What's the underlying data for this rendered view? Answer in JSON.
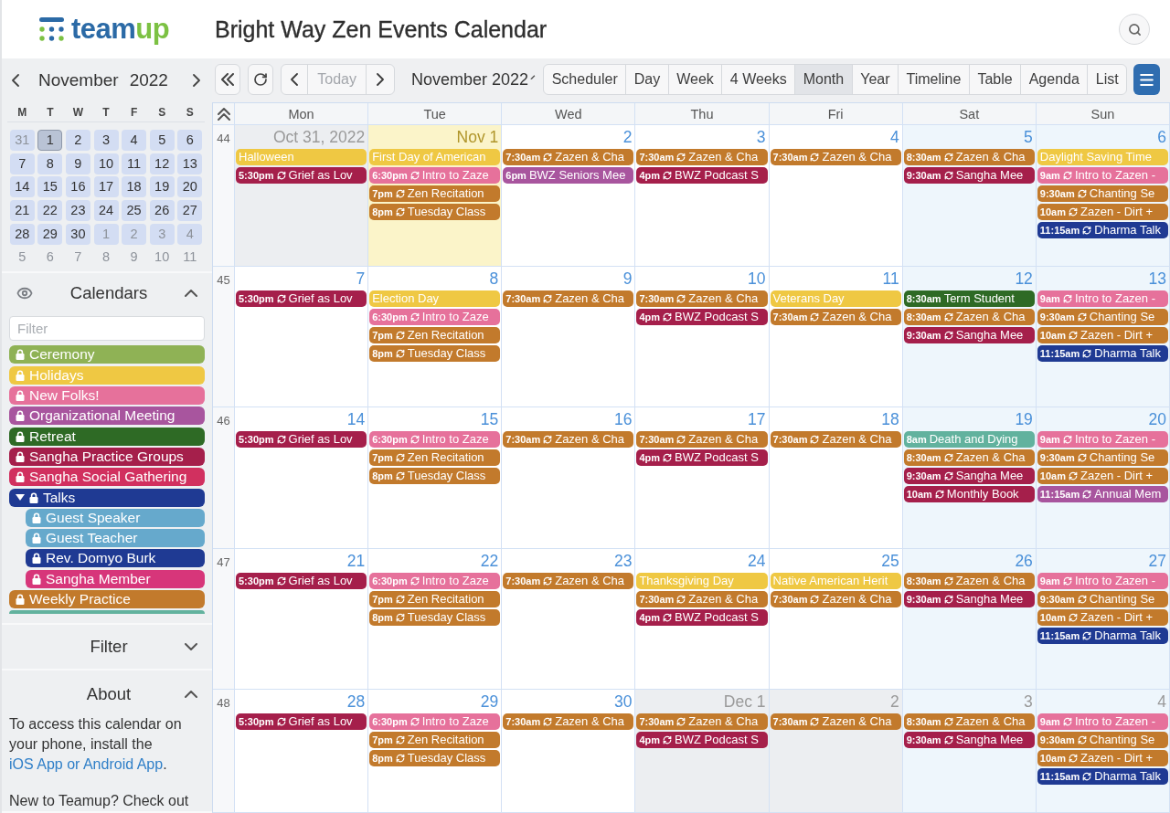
{
  "header": {
    "logo": {
      "first": "team",
      "second": "up"
    },
    "title": "Bright Way Zen Events Calendar"
  },
  "sidebar": {
    "mini_calendar": {
      "month": "November",
      "year": "2022",
      "weekdays": [
        "M",
        "T",
        "W",
        "T",
        "F",
        "S",
        "S"
      ],
      "weeks": [
        [
          {
            "label": "31",
            "in_month": false,
            "in_view": true,
            "selected": false
          },
          {
            "label": "1",
            "in_month": true,
            "in_view": true,
            "selected": true
          },
          {
            "label": "2",
            "in_month": true,
            "in_view": true,
            "selected": false
          },
          {
            "label": "3",
            "in_month": true,
            "in_view": true,
            "selected": false
          },
          {
            "label": "4",
            "in_month": true,
            "in_view": true,
            "selected": false
          },
          {
            "label": "5",
            "in_month": true,
            "in_view": true,
            "selected": false
          },
          {
            "label": "6",
            "in_month": true,
            "in_view": true,
            "selected": false
          }
        ],
        [
          {
            "label": "7",
            "in_month": true,
            "in_view": true,
            "selected": false
          },
          {
            "label": "8",
            "in_month": true,
            "in_view": true,
            "selected": false
          },
          {
            "label": "9",
            "in_month": true,
            "in_view": true,
            "selected": false
          },
          {
            "label": "10",
            "in_month": true,
            "in_view": true,
            "selected": false
          },
          {
            "label": "11",
            "in_month": true,
            "in_view": true,
            "selected": false
          },
          {
            "label": "12",
            "in_month": true,
            "in_view": true,
            "selected": false
          },
          {
            "label": "13",
            "in_month": true,
            "in_view": true,
            "selected": false
          }
        ],
        [
          {
            "label": "14",
            "in_month": true,
            "in_view": true,
            "selected": false
          },
          {
            "label": "15",
            "in_month": true,
            "in_view": true,
            "selected": false
          },
          {
            "label": "16",
            "in_month": true,
            "in_view": true,
            "selected": false
          },
          {
            "label": "17",
            "in_month": true,
            "in_view": true,
            "selected": false
          },
          {
            "label": "18",
            "in_month": true,
            "in_view": true,
            "selected": false
          },
          {
            "label": "19",
            "in_month": true,
            "in_view": true,
            "selected": false
          },
          {
            "label": "20",
            "in_month": true,
            "in_view": true,
            "selected": false
          }
        ],
        [
          {
            "label": "21",
            "in_month": true,
            "in_view": true,
            "selected": false
          },
          {
            "label": "22",
            "in_month": true,
            "in_view": true,
            "selected": false
          },
          {
            "label": "23",
            "in_month": true,
            "in_view": true,
            "selected": false
          },
          {
            "label": "24",
            "in_month": true,
            "in_view": true,
            "selected": false
          },
          {
            "label": "25",
            "in_month": true,
            "in_view": true,
            "selected": false
          },
          {
            "label": "26",
            "in_month": true,
            "in_view": true,
            "selected": false
          },
          {
            "label": "27",
            "in_month": true,
            "in_view": true,
            "selected": false
          }
        ],
        [
          {
            "label": "28",
            "in_month": true,
            "in_view": true,
            "selected": false
          },
          {
            "label": "29",
            "in_month": true,
            "in_view": true,
            "selected": false
          },
          {
            "label": "30",
            "in_month": true,
            "in_view": true,
            "selected": false
          },
          {
            "label": "1",
            "in_month": false,
            "in_view": true,
            "selected": false
          },
          {
            "label": "2",
            "in_month": false,
            "in_view": true,
            "selected": false
          },
          {
            "label": "3",
            "in_month": false,
            "in_view": true,
            "selected": false
          },
          {
            "label": "4",
            "in_month": false,
            "in_view": true,
            "selected": false
          }
        ],
        [
          {
            "label": "5",
            "in_month": false,
            "in_view": false,
            "selected": false
          },
          {
            "label": "6",
            "in_month": false,
            "in_view": false,
            "selected": false
          },
          {
            "label": "7",
            "in_month": false,
            "in_view": false,
            "selected": false
          },
          {
            "label": "8",
            "in_month": false,
            "in_view": false,
            "selected": false
          },
          {
            "label": "9",
            "in_month": false,
            "in_view": false,
            "selected": false
          },
          {
            "label": "10",
            "in_month": false,
            "in_view": false,
            "selected": false
          },
          {
            "label": "11",
            "in_month": false,
            "in_view": false,
            "selected": false
          }
        ]
      ]
    },
    "calendars": {
      "title": "Calendars",
      "expanded": true,
      "filter": {
        "placeholder": "Filter"
      },
      "items": [
        {
          "name": "Ceremony",
          "color": "#8fb255",
          "locked": true
        },
        {
          "name": "Holidays",
          "color": "#efc843",
          "locked": true
        },
        {
          "name": "New Folks!",
          "color": "#e6719b",
          "locked": true
        },
        {
          "name": "Organizational Meeting",
          "color": "#a8559e",
          "locked": true
        },
        {
          "name": "Retreat",
          "color": "#2e6a25",
          "locked": true
        },
        {
          "name": "Sangha Practice Groups",
          "color": "#a51f4b",
          "locked": true
        },
        {
          "name": "Sangha Social Gathering",
          "color": "#d1305f",
          "locked": true
        },
        {
          "name": "Talks",
          "color": "#1f3a93",
          "locked": true,
          "expanded": true,
          "children": [
            {
              "name": "Guest Speaker",
              "color": "#66a9cc",
              "locked": true
            },
            {
              "name": "Guest Teacher",
              "color": "#66a9cc",
              "locked": true
            },
            {
              "name": "Rev. Domyo Burk",
              "color": "#1f3a93",
              "locked": true
            },
            {
              "name": "Sangha Member",
              "color": "#d7367a",
              "locked": true
            }
          ]
        },
        {
          "name": "Weekly Practice",
          "color": "#c27a2c",
          "locked": true
        },
        {
          "color": "#62b29e"
        }
      ]
    },
    "filter_panel": {
      "title": "Filter",
      "expanded": false
    },
    "about_panel": {
      "title": "About",
      "expanded": true,
      "paragraphs": [
        {
          "before": "To access this calendar on your phone, install the ",
          "link": "iOS App or Android App",
          "after": "."
        },
        {
          "before": "New to Teamup? Check out"
        }
      ]
    }
  },
  "toolbar": {
    "today": {
      "label": "Today",
      "disabled": true
    },
    "title": "November 2022",
    "views": [
      {
        "label": "Scheduler",
        "selected": false
      },
      {
        "label": "Day",
        "selected": false
      },
      {
        "label": "Week",
        "selected": false
      },
      {
        "label": "4 Weeks",
        "selected": false
      },
      {
        "label": "Month",
        "selected": true
      },
      {
        "label": "Year",
        "selected": false
      },
      {
        "label": "Timeline",
        "selected": false
      },
      {
        "label": "Table",
        "selected": false
      },
      {
        "label": "Agenda",
        "selected": false
      },
      {
        "label": "List",
        "selected": false
      }
    ]
  },
  "calendar": {
    "weekdays": [
      "Mon",
      "Tue",
      "Wed",
      "Thu",
      "Fri",
      "Sat",
      "Sun"
    ],
    "weeks": [
      {
        "number": "44",
        "days": [
          {
            "label": "Oct 31, 2022",
            "in_month": false,
            "today": false,
            "events": [
              {
                "kind": "all_day",
                "title": "Halloween",
                "color": "#efc843"
              },
              {
                "kind": "timed",
                "time": "5:30pm",
                "repeat": true,
                "title": "Grief as Lov",
                "color": "#a51f4b"
              }
            ]
          },
          {
            "label": "Nov 1",
            "in_month": true,
            "today": true,
            "events": [
              {
                "kind": "all_day",
                "title": "First Day of American",
                "color": "#efc843"
              },
              {
                "kind": "timed",
                "time": "6:30pm",
                "repeat": true,
                "title": "Intro to Zaze",
                "color": "#e6719b"
              },
              {
                "kind": "timed",
                "time": "7pm",
                "repeat": true,
                "title": "Zen Recitation",
                "color": "#c27a2c"
              },
              {
                "kind": "timed",
                "time": "8pm",
                "repeat": true,
                "title": "Tuesday Class",
                "color": "#c27a2c"
              }
            ]
          },
          {
            "label": "2",
            "in_month": true,
            "today": false,
            "events": [
              {
                "kind": "timed",
                "time": "7:30am",
                "repeat": true,
                "title": "Zazen & Cha",
                "color": "#c27a2c"
              },
              {
                "kind": "timed",
                "time": "6pm",
                "repeat": false,
                "title": "BWZ Seniors Mee",
                "color": "#a8559e"
              }
            ]
          },
          {
            "label": "3",
            "in_month": true,
            "today": false,
            "events": [
              {
                "kind": "timed",
                "time": "7:30am",
                "repeat": true,
                "title": "Zazen & Cha",
                "color": "#c27a2c"
              },
              {
                "kind": "timed",
                "time": "4pm",
                "repeat": true,
                "title": "BWZ Podcast S",
                "color": "#a51f4b"
              }
            ]
          },
          {
            "label": "4",
            "in_month": true,
            "today": false,
            "events": [
              {
                "kind": "timed",
                "time": "7:30am",
                "repeat": true,
                "title": "Zazen & Cha",
                "color": "#c27a2c"
              }
            ]
          },
          {
            "label": "5",
            "in_month": true,
            "today": false,
            "events": [
              {
                "kind": "timed",
                "time": "8:30am",
                "repeat": true,
                "title": "Zazen & Cha",
                "color": "#c27a2c"
              },
              {
                "kind": "timed",
                "time": "9:30am",
                "repeat": true,
                "title": "Sangha Mee",
                "color": "#a51f4b"
              }
            ]
          },
          {
            "label": "6",
            "in_month": true,
            "today": false,
            "events": [
              {
                "kind": "all_day",
                "title": "Daylight Saving Time",
                "color": "#efc843"
              },
              {
                "kind": "timed",
                "time": "9am",
                "repeat": true,
                "title": "Intro to Zazen -",
                "color": "#e6719b"
              },
              {
                "kind": "timed",
                "time": "9:30am",
                "repeat": true,
                "title": "Chanting Se",
                "color": "#c27a2c"
              },
              {
                "kind": "timed",
                "time": "10am",
                "repeat": true,
                "title": "Zazen - Dirt +",
                "color": "#c27a2c"
              },
              {
                "kind": "timed",
                "time": "11:15am",
                "repeat": true,
                "title": "Dharma Talk",
                "color": "#1f3a93"
              }
            ]
          }
        ]
      },
      {
        "number": "45",
        "days": [
          {
            "label": "7",
            "in_month": true,
            "today": false,
            "events": [
              {
                "kind": "timed",
                "time": "5:30pm",
                "repeat": true,
                "title": "Grief as Lov",
                "color": "#a51f4b"
              }
            ]
          },
          {
            "label": "8",
            "in_month": true,
            "today": false,
            "events": [
              {
                "kind": "all_day",
                "title": "Election Day",
                "color": "#efc843"
              },
              {
                "kind": "timed",
                "time": "6:30pm",
                "repeat": true,
                "title": "Intro to Zaze",
                "color": "#e6719b"
              },
              {
                "kind": "timed",
                "time": "7pm",
                "repeat": true,
                "title": "Zen Recitation",
                "color": "#c27a2c"
              },
              {
                "kind": "timed",
                "time": "8pm",
                "repeat": true,
                "title": "Tuesday Class",
                "color": "#c27a2c"
              }
            ]
          },
          {
            "label": "9",
            "in_month": true,
            "today": false,
            "events": [
              {
                "kind": "timed",
                "time": "7:30am",
                "repeat": true,
                "title": "Zazen & Cha",
                "color": "#c27a2c"
              }
            ]
          },
          {
            "label": "10",
            "in_month": true,
            "today": false,
            "events": [
              {
                "kind": "timed",
                "time": "7:30am",
                "repeat": true,
                "title": "Zazen & Cha",
                "color": "#c27a2c"
              },
              {
                "kind": "timed",
                "time": "4pm",
                "repeat": true,
                "title": "BWZ Podcast S",
                "color": "#a51f4b"
              }
            ]
          },
          {
            "label": "11",
            "in_month": true,
            "today": false,
            "events": [
              {
                "kind": "all_day",
                "title": "Veterans Day",
                "color": "#efc843"
              },
              {
                "kind": "timed",
                "time": "7:30am",
                "repeat": true,
                "title": "Zazen & Cha",
                "color": "#c27a2c"
              }
            ]
          },
          {
            "label": "12",
            "in_month": true,
            "today": false,
            "events": [
              {
                "kind": "timed",
                "time": "8:30am",
                "repeat": false,
                "title": "Term Student",
                "color": "#2e6a25"
              },
              {
                "kind": "timed",
                "time": "8:30am",
                "repeat": true,
                "title": "Zazen & Cha",
                "color": "#c27a2c"
              },
              {
                "kind": "timed",
                "time": "9:30am",
                "repeat": true,
                "title": "Sangha Mee",
                "color": "#a51f4b"
              }
            ]
          },
          {
            "label": "13",
            "in_month": true,
            "today": false,
            "events": [
              {
                "kind": "timed",
                "time": "9am",
                "repeat": true,
                "title": "Intro to Zazen -",
                "color": "#e6719b"
              },
              {
                "kind": "timed",
                "time": "9:30am",
                "repeat": true,
                "title": "Chanting Se",
                "color": "#c27a2c"
              },
              {
                "kind": "timed",
                "time": "10am",
                "repeat": true,
                "title": "Zazen - Dirt +",
                "color": "#c27a2c"
              },
              {
                "kind": "timed",
                "time": "11:15am",
                "repeat": true,
                "title": "Dharma Talk",
                "color": "#1f3a93"
              }
            ]
          }
        ]
      },
      {
        "number": "46",
        "days": [
          {
            "label": "14",
            "in_month": true,
            "today": false,
            "events": [
              {
                "kind": "timed",
                "time": "5:30pm",
                "repeat": true,
                "title": "Grief as Lov",
                "color": "#a51f4b"
              }
            ]
          },
          {
            "label": "15",
            "in_month": true,
            "today": false,
            "events": [
              {
                "kind": "timed",
                "time": "6:30pm",
                "repeat": true,
                "title": "Intro to Zaze",
                "color": "#e6719b"
              },
              {
                "kind": "timed",
                "time": "7pm",
                "repeat": true,
                "title": "Zen Recitation",
                "color": "#c27a2c"
              },
              {
                "kind": "timed",
                "time": "8pm",
                "repeat": true,
                "title": "Tuesday Class",
                "color": "#c27a2c"
              }
            ]
          },
          {
            "label": "16",
            "in_month": true,
            "today": false,
            "events": [
              {
                "kind": "timed",
                "time": "7:30am",
                "repeat": true,
                "title": "Zazen & Cha",
                "color": "#c27a2c"
              }
            ]
          },
          {
            "label": "17",
            "in_month": true,
            "today": false,
            "events": [
              {
                "kind": "timed",
                "time": "7:30am",
                "repeat": true,
                "title": "Zazen & Cha",
                "color": "#c27a2c"
              },
              {
                "kind": "timed",
                "time": "4pm",
                "repeat": true,
                "title": "BWZ Podcast S",
                "color": "#a51f4b"
              }
            ]
          },
          {
            "label": "18",
            "in_month": true,
            "today": false,
            "events": [
              {
                "kind": "timed",
                "time": "7:30am",
                "repeat": true,
                "title": "Zazen & Cha",
                "color": "#c27a2c"
              }
            ]
          },
          {
            "label": "19",
            "in_month": true,
            "today": false,
            "events": [
              {
                "kind": "timed",
                "time": "8am",
                "repeat": false,
                "title": "Death and Dying",
                "color": "#62b29e"
              },
              {
                "kind": "timed",
                "time": "8:30am",
                "repeat": true,
                "title": "Zazen & Cha",
                "color": "#c27a2c"
              },
              {
                "kind": "timed",
                "time": "9:30am",
                "repeat": true,
                "title": "Sangha Mee",
                "color": "#a51f4b"
              },
              {
                "kind": "timed",
                "time": "10am",
                "repeat": true,
                "title": "Monthly Book",
                "color": "#a51f4b"
              }
            ]
          },
          {
            "label": "20",
            "in_month": true,
            "today": false,
            "events": [
              {
                "kind": "timed",
                "time": "9am",
                "repeat": true,
                "title": "Intro to Zazen -",
                "color": "#e6719b"
              },
              {
                "kind": "timed",
                "time": "9:30am",
                "repeat": true,
                "title": "Chanting Se",
                "color": "#c27a2c"
              },
              {
                "kind": "timed",
                "time": "10am",
                "repeat": true,
                "title": "Zazen - Dirt +",
                "color": "#c27a2c"
              },
              {
                "kind": "timed",
                "time": "11:15am",
                "repeat": true,
                "title": "Annual Mem",
                "color": "#a8559e"
              }
            ]
          }
        ]
      },
      {
        "number": "47",
        "days": [
          {
            "label": "21",
            "in_month": true,
            "today": false,
            "events": [
              {
                "kind": "timed",
                "time": "5:30pm",
                "repeat": true,
                "title": "Grief as Lov",
                "color": "#a51f4b"
              }
            ]
          },
          {
            "label": "22",
            "in_month": true,
            "today": false,
            "events": [
              {
                "kind": "timed",
                "time": "6:30pm",
                "repeat": true,
                "title": "Intro to Zaze",
                "color": "#e6719b"
              },
              {
                "kind": "timed",
                "time": "7pm",
                "repeat": true,
                "title": "Zen Recitation",
                "color": "#c27a2c"
              },
              {
                "kind": "timed",
                "time": "8pm",
                "repeat": true,
                "title": "Tuesday Class",
                "color": "#c27a2c"
              }
            ]
          },
          {
            "label": "23",
            "in_month": true,
            "today": false,
            "events": [
              {
                "kind": "timed",
                "time": "7:30am",
                "repeat": true,
                "title": "Zazen & Cha",
                "color": "#c27a2c"
              }
            ]
          },
          {
            "label": "24",
            "in_month": true,
            "today": false,
            "events": [
              {
                "kind": "all_day",
                "title": "Thanksgiving Day",
                "color": "#efc843"
              },
              {
                "kind": "timed",
                "time": "7:30am",
                "repeat": true,
                "title": "Zazen & Cha",
                "color": "#c27a2c"
              },
              {
                "kind": "timed",
                "time": "4pm",
                "repeat": true,
                "title": "BWZ Podcast S",
                "color": "#a51f4b"
              }
            ]
          },
          {
            "label": "25",
            "in_month": true,
            "today": false,
            "events": [
              {
                "kind": "all_day",
                "title": "Native American Herit",
                "color": "#efc843"
              },
              {
                "kind": "timed",
                "time": "7:30am",
                "repeat": true,
                "title": "Zazen & Cha",
                "color": "#c27a2c"
              }
            ]
          },
          {
            "label": "26",
            "in_month": true,
            "today": false,
            "events": [
              {
                "kind": "timed",
                "time": "8:30am",
                "repeat": true,
                "title": "Zazen & Cha",
                "color": "#c27a2c"
              },
              {
                "kind": "timed",
                "time": "9:30am",
                "repeat": true,
                "title": "Sangha Mee",
                "color": "#a51f4b"
              }
            ]
          },
          {
            "label": "27",
            "in_month": true,
            "today": false,
            "events": [
              {
                "kind": "timed",
                "time": "9am",
                "repeat": true,
                "title": "Intro to Zazen -",
                "color": "#e6719b"
              },
              {
                "kind": "timed",
                "time": "9:30am",
                "repeat": true,
                "title": "Chanting Se",
                "color": "#c27a2c"
              },
              {
                "kind": "timed",
                "time": "10am",
                "repeat": true,
                "title": "Zazen - Dirt +",
                "color": "#c27a2c"
              },
              {
                "kind": "timed",
                "time": "11:15am",
                "repeat": true,
                "title": "Dharma Talk",
                "color": "#1f3a93"
              }
            ]
          }
        ]
      },
      {
        "number": "48",
        "days": [
          {
            "label": "28",
            "in_month": true,
            "today": false,
            "events": [
              {
                "kind": "timed",
                "time": "5:30pm",
                "repeat": true,
                "title": "Grief as Lov",
                "color": "#a51f4b"
              }
            ]
          },
          {
            "label": "29",
            "in_month": true,
            "today": false,
            "events": [
              {
                "kind": "timed",
                "time": "6:30pm",
                "repeat": true,
                "title": "Intro to Zaze",
                "color": "#e6719b"
              },
              {
                "kind": "timed",
                "time": "7pm",
                "repeat": true,
                "title": "Zen Recitation",
                "color": "#c27a2c"
              },
              {
                "kind": "timed",
                "time": "8pm",
                "repeat": true,
                "title": "Tuesday Class",
                "color": "#c27a2c"
              }
            ]
          },
          {
            "label": "30",
            "in_month": true,
            "today": false,
            "events": [
              {
                "kind": "timed",
                "time": "7:30am",
                "repeat": true,
                "title": "Zazen & Cha",
                "color": "#c27a2c"
              }
            ]
          },
          {
            "label": "Dec 1",
            "in_month": false,
            "today": false,
            "events": [
              {
                "kind": "timed",
                "time": "7:30am",
                "repeat": true,
                "title": "Zazen & Cha",
                "color": "#c27a2c"
              },
              {
                "kind": "timed",
                "time": "4pm",
                "repeat": true,
                "title": "BWZ Podcast S",
                "color": "#a51f4b"
              }
            ]
          },
          {
            "label": "2",
            "in_month": false,
            "today": false,
            "events": [
              {
                "kind": "timed",
                "time": "7:30am",
                "repeat": true,
                "title": "Zazen & Cha",
                "color": "#c27a2c"
              }
            ]
          },
          {
            "label": "3",
            "in_month": false,
            "today": false,
            "events": [
              {
                "kind": "timed",
                "time": "8:30am",
                "repeat": true,
                "title": "Zazen & Cha",
                "color": "#c27a2c"
              },
              {
                "kind": "timed",
                "time": "9:30am",
                "repeat": true,
                "title": "Sangha Mee",
                "color": "#a51f4b"
              }
            ]
          },
          {
            "label": "4",
            "in_month": false,
            "today": false,
            "events": [
              {
                "kind": "timed",
                "time": "9am",
                "repeat": true,
                "title": "Intro to Zazen -",
                "color": "#e6719b"
              },
              {
                "kind": "timed",
                "time": "9:30am",
                "repeat": true,
                "title": "Chanting Se",
                "color": "#c27a2c"
              },
              {
                "kind": "timed",
                "time": "10am",
                "repeat": true,
                "title": "Zazen - Dirt +",
                "color": "#c27a2c"
              },
              {
                "kind": "timed",
                "time": "11:15am",
                "repeat": true,
                "title": "Dharma Talk",
                "color": "#1f3a93"
              }
            ]
          }
        ]
      }
    ]
  }
}
